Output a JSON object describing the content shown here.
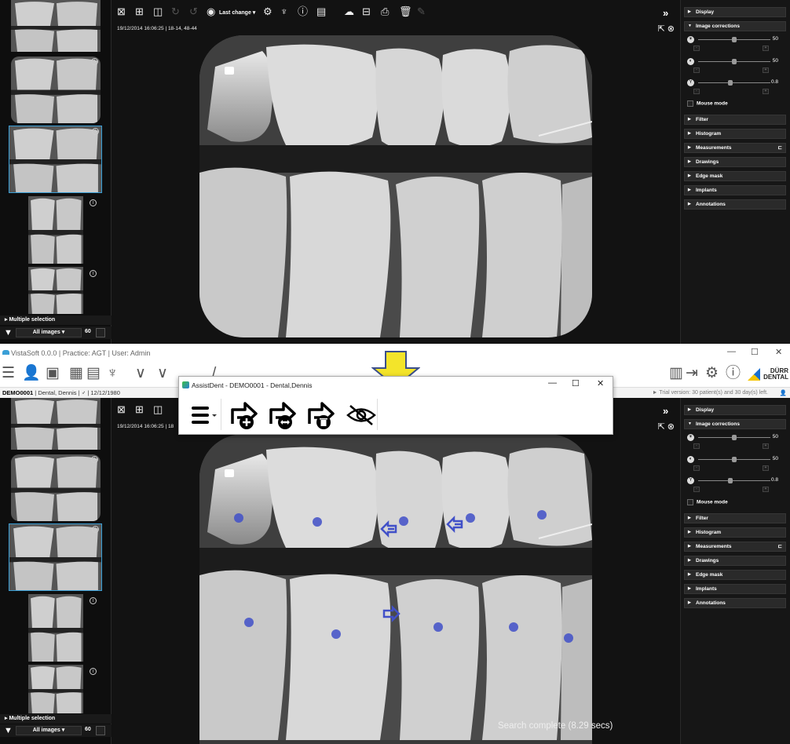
{
  "top_view": {
    "toolbar": {
      "last_change_label": "Last change"
    },
    "date_line": "19/12/2014 16:06:25 | 18-14, 48-44",
    "multiple_selection": "Multiple selection",
    "filter_select": "All images",
    "image_count": "60"
  },
  "right_panel": {
    "sections": {
      "display": "Display",
      "image_corrections": "Image corrections",
      "filter": "Filter",
      "histogram": "Histogram",
      "measurements": "Measurements",
      "drawings": "Drawings",
      "edge_mask": "Edge mask",
      "implants": "Implants",
      "annotations": "Annotations"
    },
    "brightness_value": "50",
    "contrast_value": "50",
    "gamma_value": "0.8",
    "gamma_icon_label": "Y",
    "mouse_mode": "Mouse mode",
    "collapse_label": "»"
  },
  "app": {
    "title": "VistaSoft 0.0.0 | Practice: AGT | User: Admin",
    "brand": "DÜRR DENTAL",
    "patient_id": "DEMO0001",
    "patient_info": "Dental, Dennis | ♂ | 12/12/1980",
    "trial_text": "► Trial version: 30 patient(s) and 30 day(s) left."
  },
  "assist_dialog": {
    "title": "AssistDent - DEMO0001 - Dental,Dennis"
  },
  "bottom_view": {
    "date_line": "19/12/2014 16:06:25 | 18",
    "search_status": "Search complete (8.29 secs)",
    "multiple_selection": "Multiple selection",
    "filter_select": "All images",
    "image_count": "60"
  },
  "colors": {
    "accent_blue": "#3a9fd6",
    "marker_blue": "#4150c8",
    "arrow_yellow": "#f3e42a"
  }
}
